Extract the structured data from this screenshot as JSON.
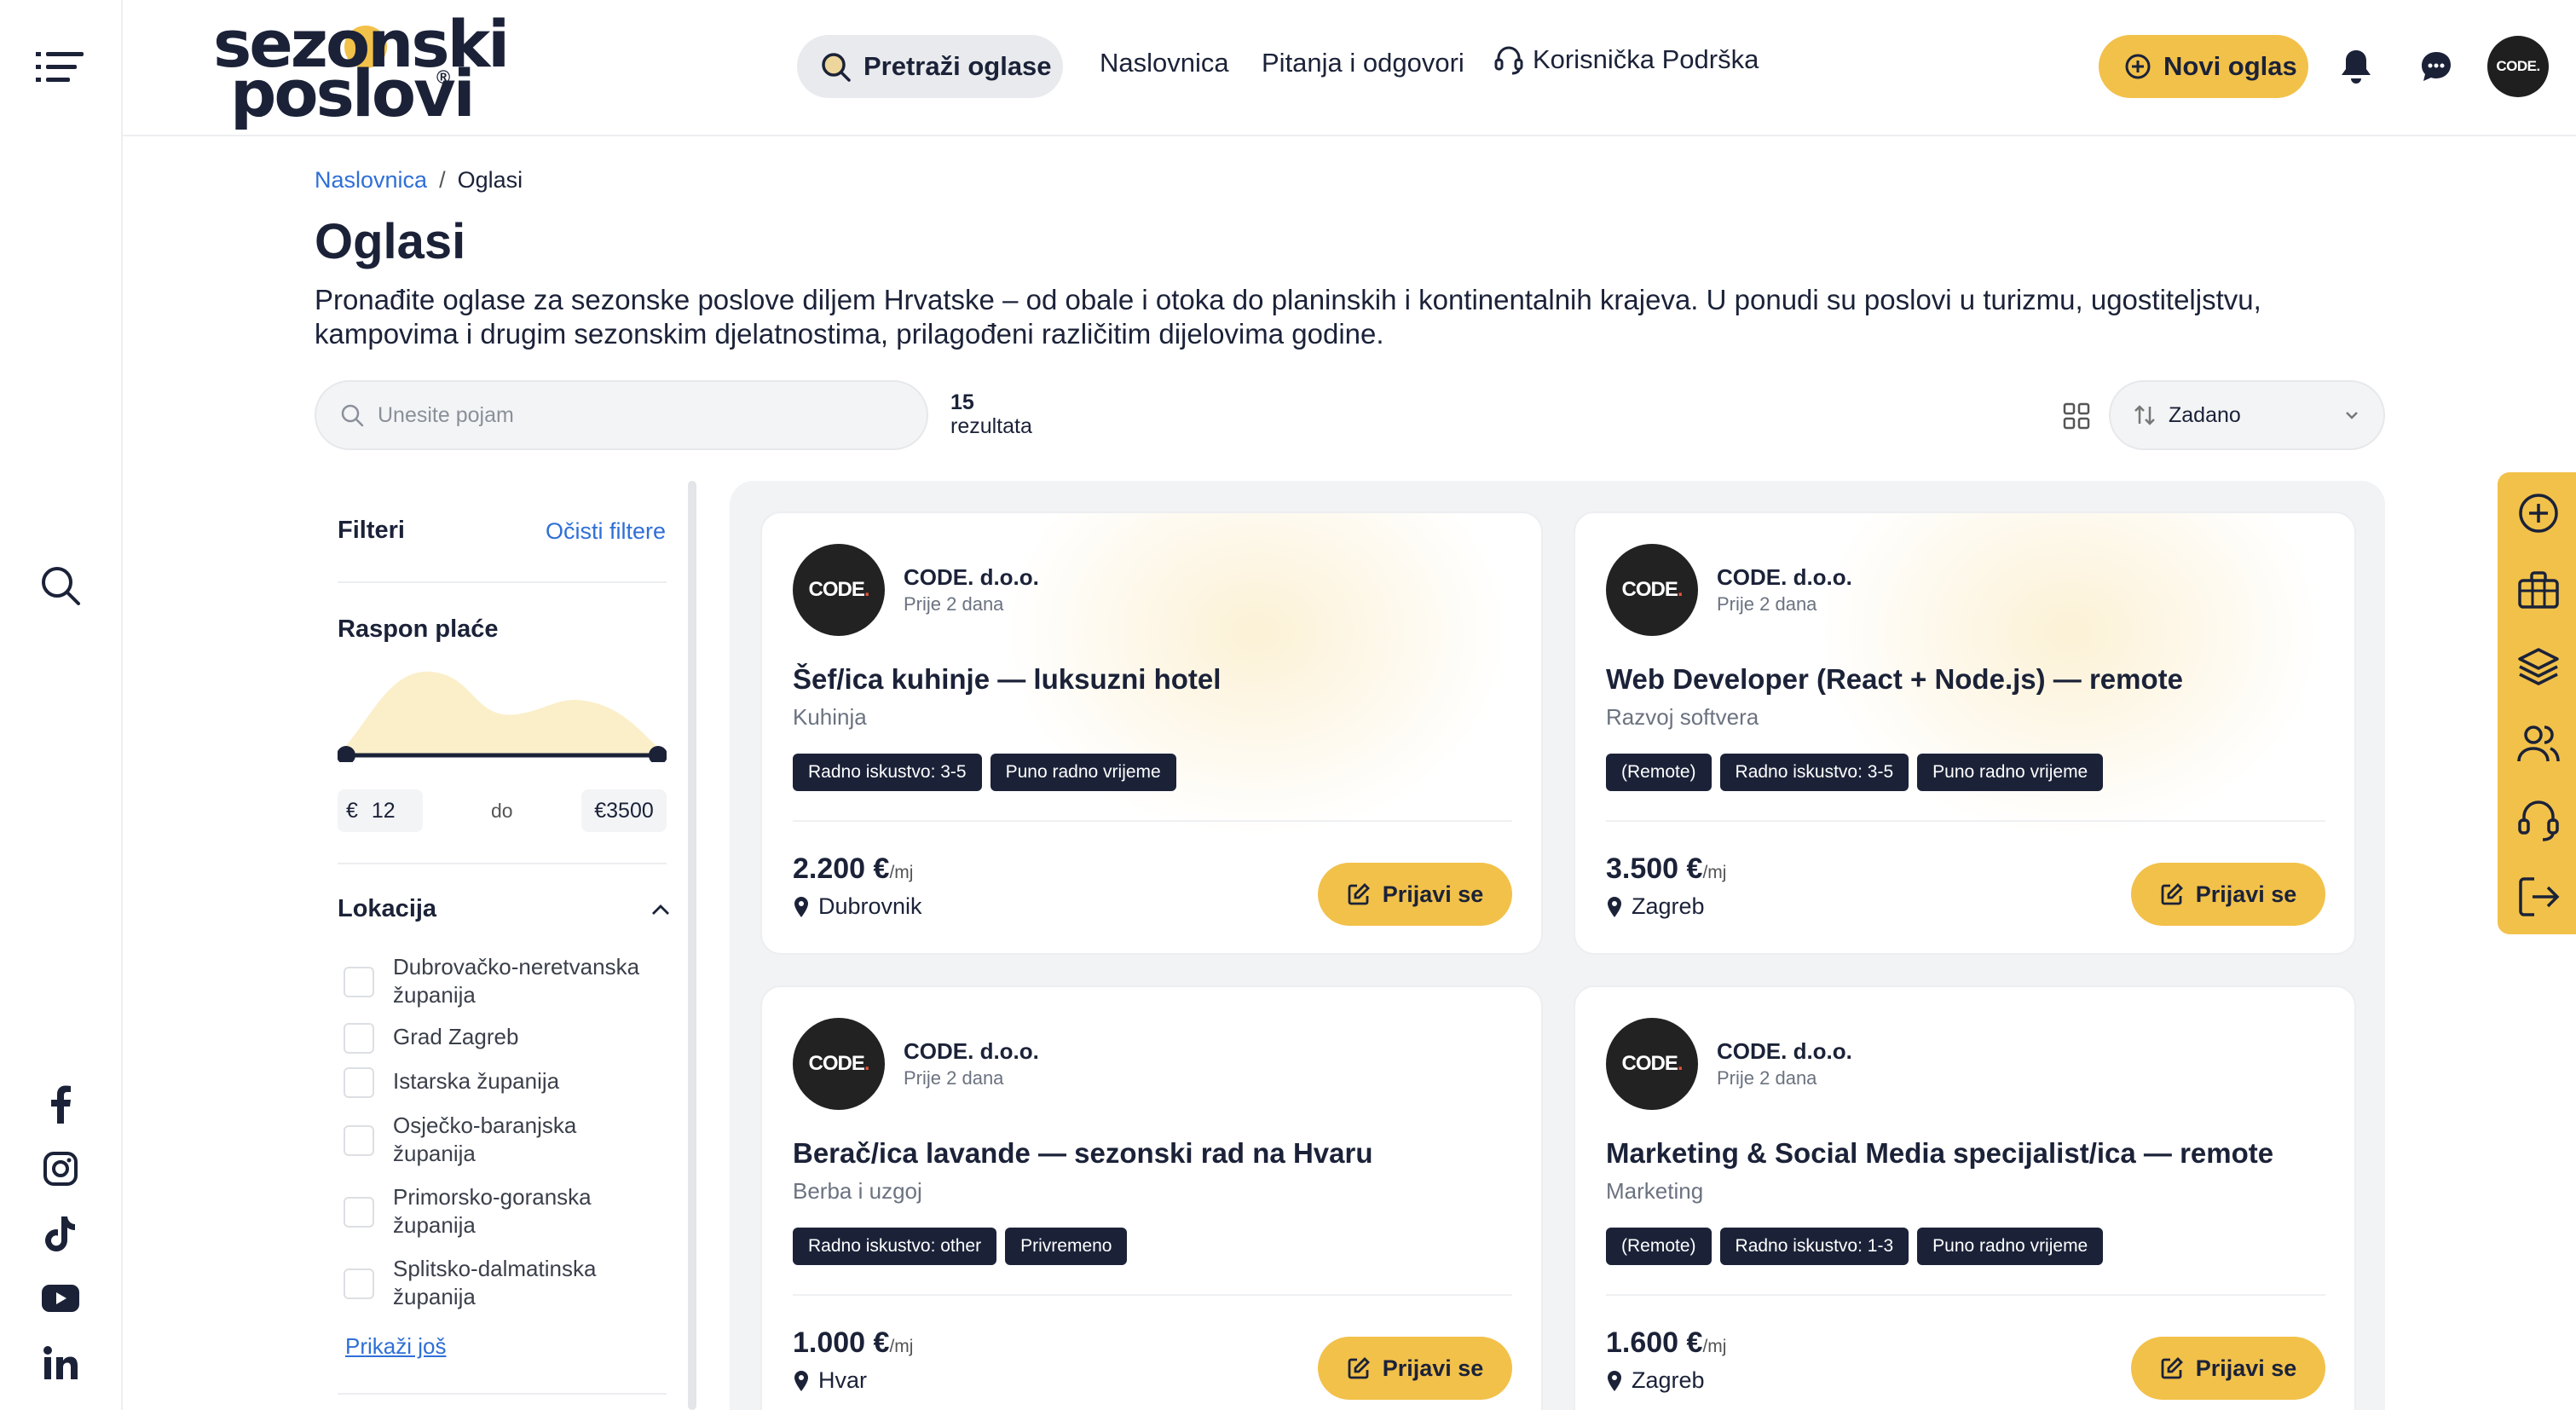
{
  "header": {
    "logo_line1": "sezonski",
    "logo_line2": "poslovi",
    "logo_reg": "®",
    "search_label": "Pretraži oglase",
    "nav": [
      "Naslovnica",
      "Pitanja i odgovori",
      "Korisnička Podrška"
    ],
    "new_ad_label": "Novi oglas",
    "avatar_text": "CODE."
  },
  "breadcrumb": {
    "home": "Naslovnica",
    "sep": "/",
    "current": "Oglasi"
  },
  "page": {
    "title": "Oglasi",
    "description": "Pronađite oglase za sezonske poslove diljem Hrvatske – od obale i otoka do planinskih i kontinentalnih krajeva. U ponudi su poslovi u turizmu, ugostiteljstvu, kampovima i drugim sezonskim djelatnostima, prilagođeni različitim dijelovima godine."
  },
  "toolbar": {
    "search_placeholder": "Unesite pojam",
    "results_count": "15",
    "results_label": "rezultata",
    "sort_value": "Zadano"
  },
  "filters": {
    "title": "Filteri",
    "clear": "Očisti filtere",
    "salary_title": "Raspon plaće",
    "salary_currency": "€",
    "salary_min": "12",
    "salary_to": "do",
    "salary_max": "€3500",
    "location_title": "Lokacija",
    "locations": [
      {
        "line1": "Dubrovačko-neretvanska",
        "line2": "županija"
      },
      {
        "line1": "Grad Zagreb",
        "line2": ""
      },
      {
        "line1": "Istarska županija",
        "line2": ""
      },
      {
        "line1": "Osječko-baranjska",
        "line2": "županija"
      },
      {
        "line1": "Primorsko-goranska",
        "line2": "županija"
      },
      {
        "line1": "Splitsko-dalmatinska",
        "line2": "županija"
      }
    ],
    "show_more": "Prikaži još"
  },
  "cards": [
    {
      "logo": "CODE",
      "logo_dot": ".",
      "company": "CODE. d.o.o.",
      "posted": "Prije 2 dana",
      "title": "Šef/ica kuhinje — luksuzni hotel",
      "category": "Kuhinja",
      "tags": [
        "Radno iskustvo: 3-5",
        "Puno radno vrijeme"
      ],
      "pay": "2.200 €",
      "pay_unit": "/mj",
      "location": "Dubrovnik",
      "apply": "Prijavi se"
    },
    {
      "logo": "CODE",
      "logo_dot": ".",
      "company": "CODE. d.o.o.",
      "posted": "Prije 2 dana",
      "title": "Web Developer (React + Node.js) — remote",
      "category": "Razvoj softvera",
      "tags": [
        "(Remote)",
        "Radno iskustvo: 3-5",
        "Puno radno vrijeme"
      ],
      "pay": "3.500 €",
      "pay_unit": "/mj",
      "location": "Zagreb",
      "apply": "Prijavi se"
    },
    {
      "logo": "CODE",
      "logo_dot": ".",
      "company": "CODE. d.o.o.",
      "posted": "Prije 2 dana",
      "title": "Berač/ica lavande — sezonski rad na Hvaru",
      "category": "Berba i uzgoj",
      "tags": [
        "Radno iskustvo: other",
        "Privremeno"
      ],
      "pay": "1.000 €",
      "pay_unit": "/mj",
      "location": "Hvar",
      "apply": "Prijavi se"
    },
    {
      "logo": "CODE",
      "logo_dot": ".",
      "company": "CODE. d.o.o.",
      "posted": "Prije 2 dana",
      "title": "Marketing & Social Media specijalist/ica — remote",
      "category": "Marketing",
      "tags": [
        "(Remote)",
        "Radno iskustvo: 1-3",
        "Puno radno vrijeme"
      ],
      "pay": "1.600 €",
      "pay_unit": "/mj",
      "location": "Zagreb",
      "apply": "Prijavi se"
    }
  ],
  "colors": {
    "accent": "#f2c14a",
    "dark": "#1b2238",
    "link": "#2f6fd6"
  },
  "icons": {
    "rail": [
      "menu-icon",
      "search-icon",
      "facebook-icon",
      "instagram-icon",
      "tiktok-icon",
      "youtube-icon",
      "linkedin-icon"
    ],
    "right_rail": [
      "add-circle-icon",
      "briefcase-icon",
      "layers-icon",
      "users-icon",
      "support-icon",
      "logout-icon"
    ]
  }
}
